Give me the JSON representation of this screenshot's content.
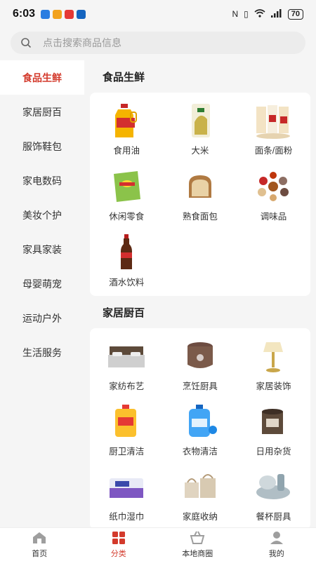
{
  "status_bar": {
    "time": "6:03",
    "battery": "70"
  },
  "search": {
    "placeholder": "点击搜索商品信息"
  },
  "sidebar": {
    "items": [
      {
        "label": "食品生鲜"
      },
      {
        "label": "家居厨百"
      },
      {
        "label": "服饰鞋包"
      },
      {
        "label": "家电数码"
      },
      {
        "label": "美妆个护"
      },
      {
        "label": "家具家装"
      },
      {
        "label": "母婴萌宠"
      },
      {
        "label": "运动户外"
      },
      {
        "label": "生活服务"
      }
    ]
  },
  "sections": [
    {
      "title": "食品生鲜",
      "items": [
        {
          "label": "食用油",
          "icon": "cooking-oil-icon"
        },
        {
          "label": "大米",
          "icon": "rice-icon"
        },
        {
          "label": "面条/面粉",
          "icon": "noodles-flour-icon"
        },
        {
          "label": "休闲零食",
          "icon": "snacks-icon"
        },
        {
          "label": "熟食面包",
          "icon": "bread-icon"
        },
        {
          "label": "调味品",
          "icon": "seasoning-icon"
        },
        {
          "label": "酒水饮料",
          "icon": "beverage-icon"
        }
      ]
    },
    {
      "title": "家居厨百",
      "items": [
        {
          "label": "家纺布艺",
          "icon": "bedding-icon"
        },
        {
          "label": "烹饪厨具",
          "icon": "rice-cooker-icon"
        },
        {
          "label": "家居装饰",
          "icon": "lamp-icon"
        },
        {
          "label": "厨卫清洁",
          "icon": "detergent-icon"
        },
        {
          "label": "衣物清洁",
          "icon": "laundry-icon"
        },
        {
          "label": "日用杂货",
          "icon": "sundries-icon"
        },
        {
          "label": "纸巾湿巾",
          "icon": "tissue-icon"
        },
        {
          "label": "家庭收纳",
          "icon": "storage-basket-icon"
        },
        {
          "label": "餐杯厨具",
          "icon": "tableware-icon"
        }
      ]
    }
  ],
  "tabbar": {
    "items": [
      {
        "label": "首页"
      },
      {
        "label": "分类"
      },
      {
        "label": "本地商圈"
      },
      {
        "label": "我的"
      }
    ]
  },
  "colors": {
    "accent": "#d33a2c",
    "background": "#f5f5f5"
  }
}
